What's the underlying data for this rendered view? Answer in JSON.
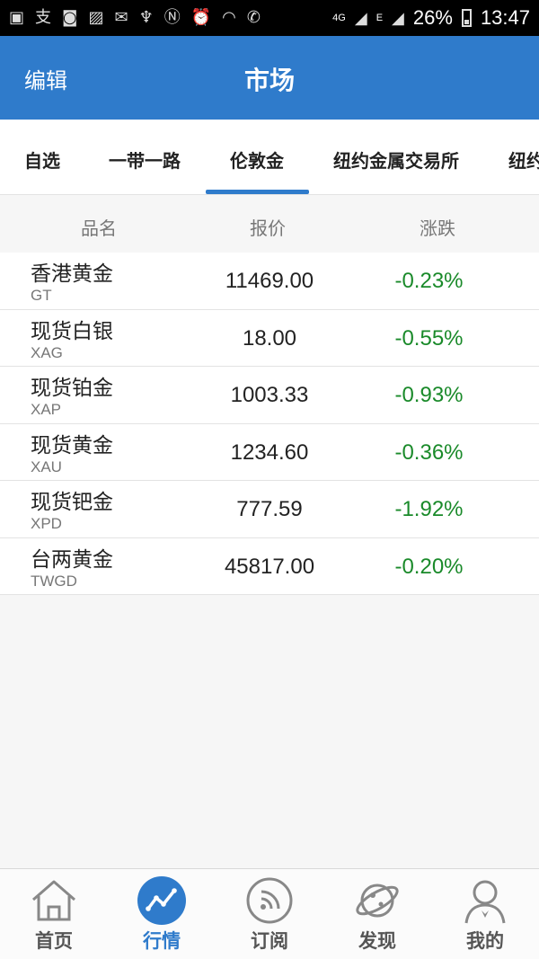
{
  "status_bar": {
    "left_icons": [
      "app-icon",
      "alipay-icon",
      "bag-icon",
      "image-icon",
      "mail-icon",
      "usb-icon",
      "nfc-icon",
      "alarm-icon",
      "wifi-icon",
      "phone-icon",
      "signal-icon"
    ],
    "network_4g": "4G",
    "network_e": "E",
    "battery": "26%",
    "time": "13:47"
  },
  "header": {
    "edit_label": "编辑",
    "title": "市场"
  },
  "tabs": [
    {
      "label": "自选",
      "active": false
    },
    {
      "label": "一带一路",
      "active": false
    },
    {
      "label": "伦敦金",
      "active": true
    },
    {
      "label": "纽约金属交易所",
      "active": false
    },
    {
      "label": "纽约",
      "active": false
    }
  ],
  "columns": {
    "name": "品名",
    "price": "报价",
    "change": "涨跌"
  },
  "rows": [
    {
      "name": "香港黄金",
      "code": "GT",
      "price": "11469.00",
      "change": "-0.23%"
    },
    {
      "name": "现货白银",
      "code": "XAG",
      "price": "18.00",
      "change": "-0.55%"
    },
    {
      "name": "现货铂金",
      "code": "XAP",
      "price": "1003.33",
      "change": "-0.93%"
    },
    {
      "name": "现货黄金",
      "code": "XAU",
      "price": "1234.60",
      "change": "-0.36%"
    },
    {
      "name": "现货钯金",
      "code": "XPD",
      "price": "777.59",
      "change": "-1.92%"
    },
    {
      "name": "台两黄金",
      "code": "TWGD",
      "price": "45817.00",
      "change": "-0.20%"
    }
  ],
  "bottom_nav": [
    {
      "label": "首页",
      "icon": "home-icon",
      "active": false
    },
    {
      "label": "行情",
      "icon": "chart-icon",
      "active": true
    },
    {
      "label": "订阅",
      "icon": "rss-icon",
      "active": false
    },
    {
      "label": "发现",
      "icon": "planet-icon",
      "active": false
    },
    {
      "label": "我的",
      "icon": "profile-icon",
      "active": false
    }
  ],
  "colors": {
    "primary": "#2f7bcb",
    "down": "#1a8a2a",
    "text": "#222222",
    "subtext": "#777777"
  }
}
